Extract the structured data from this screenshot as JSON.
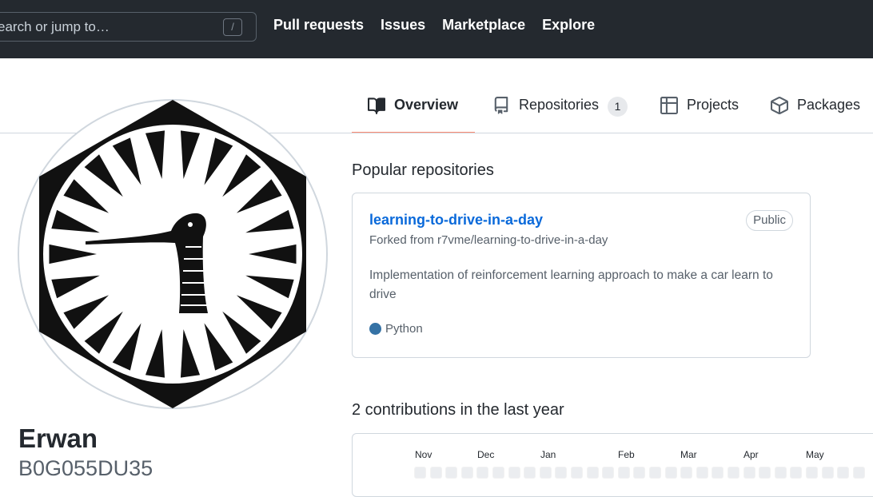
{
  "header": {
    "search_placeholder": "earch or jump to…",
    "search_shortcut": "/",
    "nav": [
      "Pull requests",
      "Issues",
      "Marketplace",
      "Explore"
    ]
  },
  "tabs": [
    {
      "label": "Overview",
      "icon": "book-icon",
      "active": true
    },
    {
      "label": "Repositories",
      "icon": "repo-icon",
      "count": "1"
    },
    {
      "label": "Projects",
      "icon": "table-icon"
    },
    {
      "label": "Packages",
      "icon": "package-icon"
    }
  ],
  "profile": {
    "fullname": "Erwan",
    "username": "B0G055DU35"
  },
  "popular": {
    "title": "Popular repositories",
    "repo": {
      "name": "learning-to-drive-in-a-day",
      "visibility": "Public",
      "forked_from": "Forked from r7vme/learning-to-drive-in-a-day",
      "description": "Implementation of reinforcement learning approach to make a car learn to drive",
      "language": "Python",
      "language_color": "#3572A5"
    }
  },
  "contributions": {
    "title": "2 contributions in the last year",
    "months": [
      "Nov",
      "Dec",
      "Jan",
      "Feb",
      "Mar",
      "Apr",
      "May"
    ]
  },
  "colors": {
    "header_bg": "#24292f",
    "link": "#0969da",
    "tab_underline": "#fd8c73",
    "empty_cell": "#ebedf0"
  }
}
